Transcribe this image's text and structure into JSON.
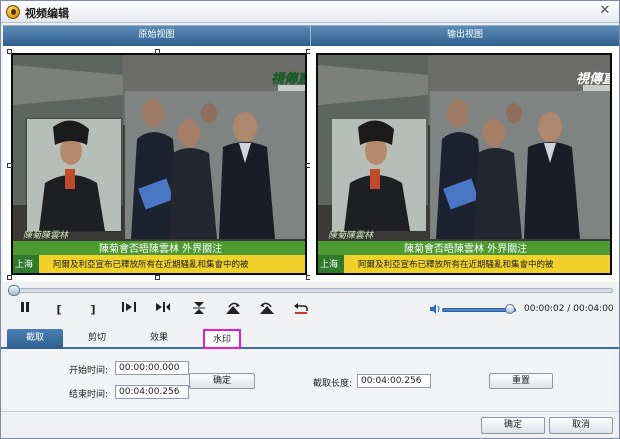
{
  "window": {
    "title": "视频编辑",
    "close_label": "✕"
  },
  "views": {
    "original_label": "原始视图",
    "output_label": "输出视图"
  },
  "video": {
    "channel_logo": "視傳直播",
    "headline": "陳菊會否晤陳雲林  外界關注",
    "ticker_city": "上海",
    "ticker_text": "阿爾及利亞宣布已釋放所有在近期騷亂和集會中的被",
    "corner_logo": "陳菊陳雲林"
  },
  "playback": {
    "progress": 0.008,
    "volume": 0.92,
    "time_current": "00:00:02",
    "time_total": "00:04:00",
    "time_separator": "/",
    "buttons": {
      "pause": "pause-icon",
      "mark_in": "[",
      "mark_out": "]",
      "play_segment": "play-segment-icon",
      "next": "skip-icon",
      "flip_v": "flip-vertical-icon",
      "rotate_right": "rotate-right-icon",
      "rotate_left": "rotate-left-icon",
      "undo": "undo-icon"
    }
  },
  "tabs": [
    {
      "label": "截取",
      "active": true
    },
    {
      "label": "剪切",
      "active": false
    },
    {
      "label": "效果",
      "active": false
    },
    {
      "label": "水印",
      "active": false,
      "highlighted": true
    }
  ],
  "trim": {
    "start_label": "开始时间:",
    "start_value": "00:00:00.000",
    "end_label": "结束时间:",
    "end_value": "00:04:00.256",
    "confirm_label": "确定",
    "length_label": "截取长度:",
    "length_value": "00:04:00.256",
    "reset_label": "重置"
  },
  "footer": {
    "ok_label": "确定",
    "cancel_label": "取消"
  },
  "colors": {
    "accent": "#2f5f8f",
    "highlight_tab_border": "#e21bd4",
    "ticker_green": "#3f8a2a",
    "ticker_yellow": "#f2d21a"
  }
}
